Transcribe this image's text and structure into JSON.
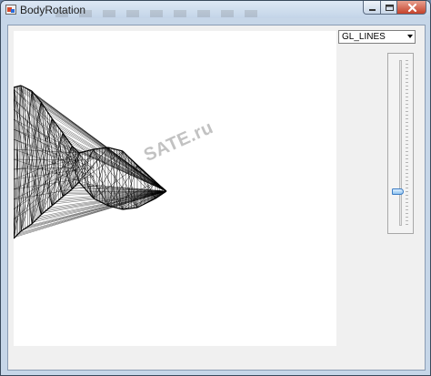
{
  "window": {
    "title": "BodyRotation",
    "icon": "app-icon",
    "controls": [
      "minimize-icon",
      "maximize-icon",
      "close-icon"
    ]
  },
  "primitive_select": {
    "selected": "GL_LINES"
  },
  "rotation_slider": {
    "value_fraction": 0.18,
    "orientation": "vertical"
  },
  "watermark": {
    "text": "SATE.ru"
  },
  "colors": {
    "canvas": "#ffffff",
    "mesh": "#000000",
    "client": "#f0f0f0",
    "titlebar": "#c6d6e8",
    "close": "#c4412a"
  }
}
